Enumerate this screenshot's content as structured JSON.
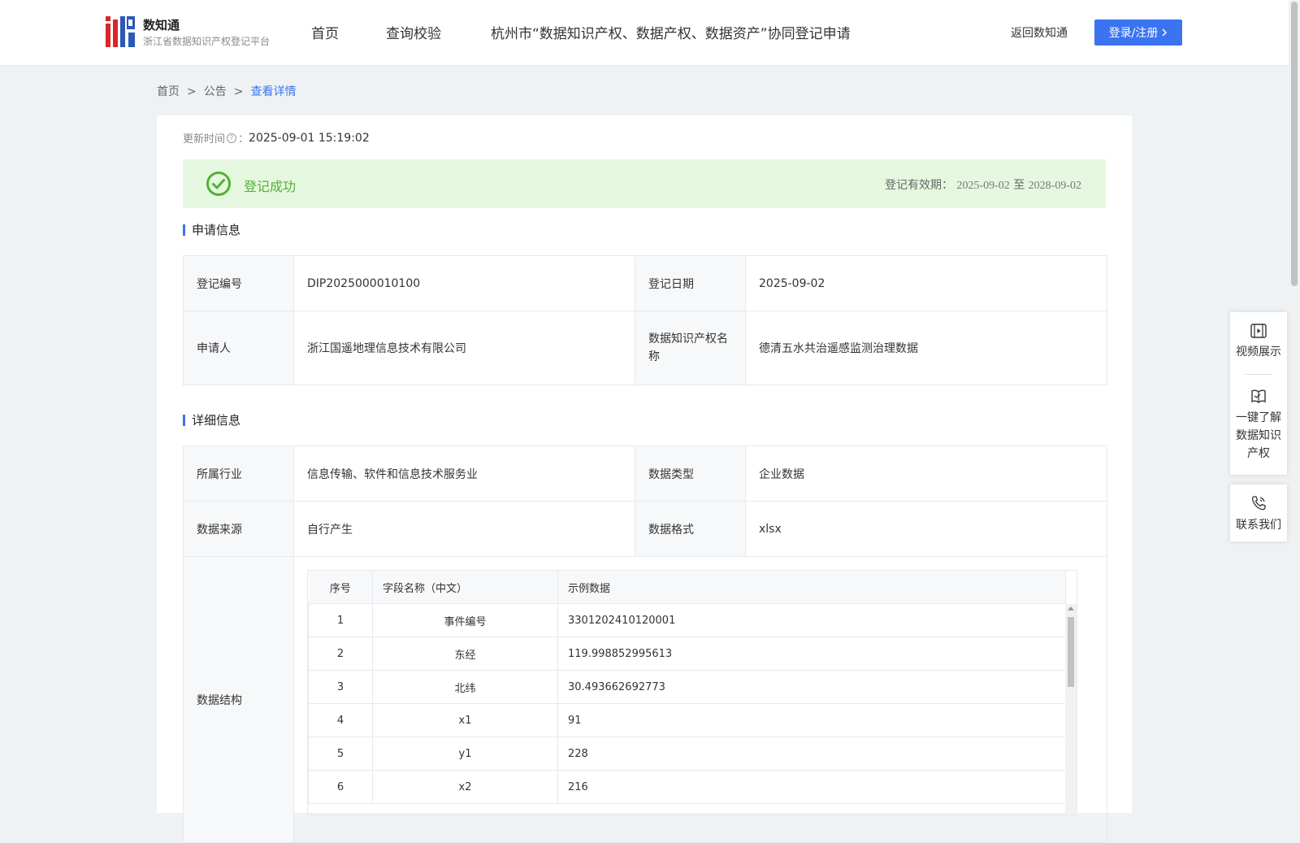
{
  "header": {
    "logo_name": "数知通",
    "logo_subtitle": "浙江省数据知识产权登记平台",
    "nav": [
      "首页",
      "查询校验",
      "杭州市“数据知识产权、数据产权、数据资产”协同登记申请"
    ],
    "back_link": "返回数知通",
    "login_label": "登录/注册"
  },
  "breadcrumb": {
    "items": [
      "首页",
      "公告",
      "查看详情"
    ],
    "separator": ">"
  },
  "update": {
    "label": "更新时间",
    "colon": "：",
    "value": "2025-09-01 15:19:02"
  },
  "status": {
    "text": "登记成功",
    "validity_label": "登记有效期：",
    "validity_from": "2025-09-02",
    "validity_to_word": "至",
    "validity_to": "2028-09-02",
    "color": "#52b135"
  },
  "application": {
    "title": "申请信息",
    "reg_no_label": "登记编号",
    "reg_no": "DIP2025000010100",
    "reg_date_label": "登记日期",
    "reg_date": "2025-09-02",
    "applicant_label": "申请人",
    "applicant": "浙江国遥地理信息技术有限公司",
    "ip_name_label": "数据知识产权名称",
    "ip_name": "德清五水共治遥感监测治理数据"
  },
  "details": {
    "title": "详细信息",
    "industry_label": "所属行业",
    "industry": "信息传输、软件和信息技术服务业",
    "data_type_label": "数据类型",
    "data_type": "企业数据",
    "source_label": "数据来源",
    "source": "自行产生",
    "format_label": "数据格式",
    "format": "xlsx",
    "structure_label": "数据结构",
    "columns": [
      "序号",
      "字段名称（中文）",
      "示例数据"
    ],
    "rows": [
      {
        "no": "1",
        "field": "事件编号",
        "sample": "3301202410120001"
      },
      {
        "no": "2",
        "field": "东经",
        "sample": "119.998852995613"
      },
      {
        "no": "3",
        "field": "北纬",
        "sample": "30.493662692773"
      },
      {
        "no": "4",
        "field": "x1",
        "sample": "91"
      },
      {
        "no": "5",
        "field": "y1",
        "sample": "228"
      },
      {
        "no": "6",
        "field": "x2",
        "sample": "216"
      }
    ]
  },
  "side_panel": {
    "video": "视频展示",
    "learn": [
      "一键了解",
      "数据知识",
      "产权"
    ],
    "contact": "联系我们"
  },
  "colors": {
    "accent": "#3a74f0",
    "success_bg": "#e6f7df",
    "page_bg": "#eef2f5"
  }
}
